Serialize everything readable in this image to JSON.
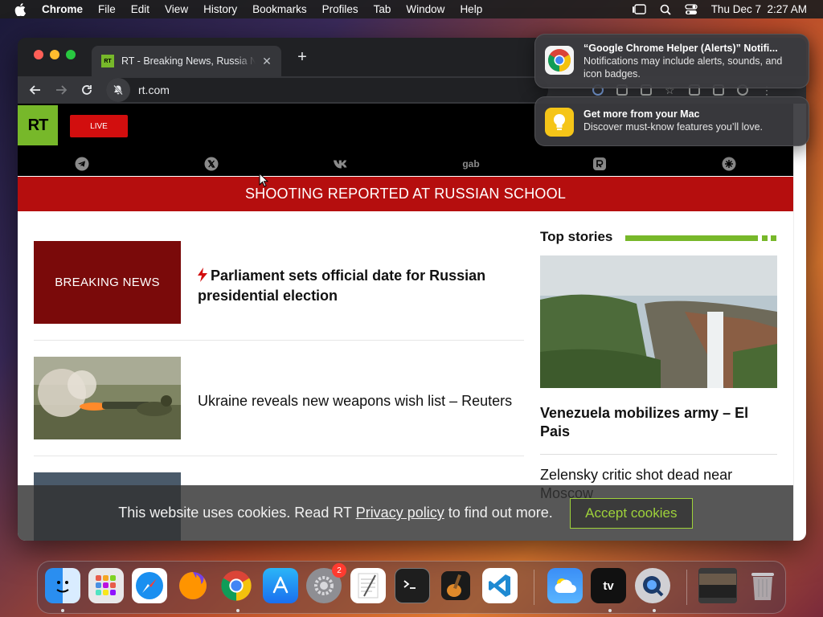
{
  "menubar": {
    "app_name": "Chrome",
    "items": [
      "File",
      "Edit",
      "View",
      "History",
      "Bookmarks",
      "Profiles",
      "Tab",
      "Window",
      "Help"
    ],
    "clock": "Thu Dec 7  2:27 AM"
  },
  "browser": {
    "tab_title": "RT - Breaking News, Russia News",
    "favicon_text": "RT",
    "address": "rt.com"
  },
  "site": {
    "logo": "RT",
    "live_label": "LIVE",
    "social_gab": "gab",
    "banner": "SHOOTING REPORTED AT RUSSIAN SCHOOL",
    "news": [
      {
        "title": "Parliament sets official date for Russian presidential election",
        "thumb_text": "BREAKING NEWS"
      },
      {
        "title": "Ukraine reveals new weapons wish list – Reuters"
      }
    ],
    "top_stories": {
      "heading": "Top stories",
      "stories": [
        "Venezuela mobilizes army – El Pais",
        "Zelensky critic shot dead near Moscow"
      ]
    },
    "cookie": {
      "text_before": "This website uses cookies. Read RT ",
      "link": "Privacy policy",
      "text_after": " to find out more.",
      "button": "Accept cookies"
    }
  },
  "notifications": [
    {
      "title": "“Google Chrome Helper (Alerts)” Notifi...",
      "body": "Notifications may include alerts, sounds, and icon badges."
    },
    {
      "title": "Get more from your Mac",
      "body": "Discover must-know features you’ll love."
    }
  ],
  "dock": {
    "settings_badge": "2",
    "apps": [
      "finder-icon",
      "launchpad-icon",
      "safari-icon",
      "firefox-icon",
      "chrome-icon",
      "app-store-icon",
      "system-settings-icon",
      "textedit-icon",
      "terminal-icon",
      "garageband-icon",
      "vscode-icon",
      "weather-icon",
      "apple-tv-icon",
      "quicktime-icon",
      "window-preview-icon",
      "trash-icon"
    ]
  }
}
